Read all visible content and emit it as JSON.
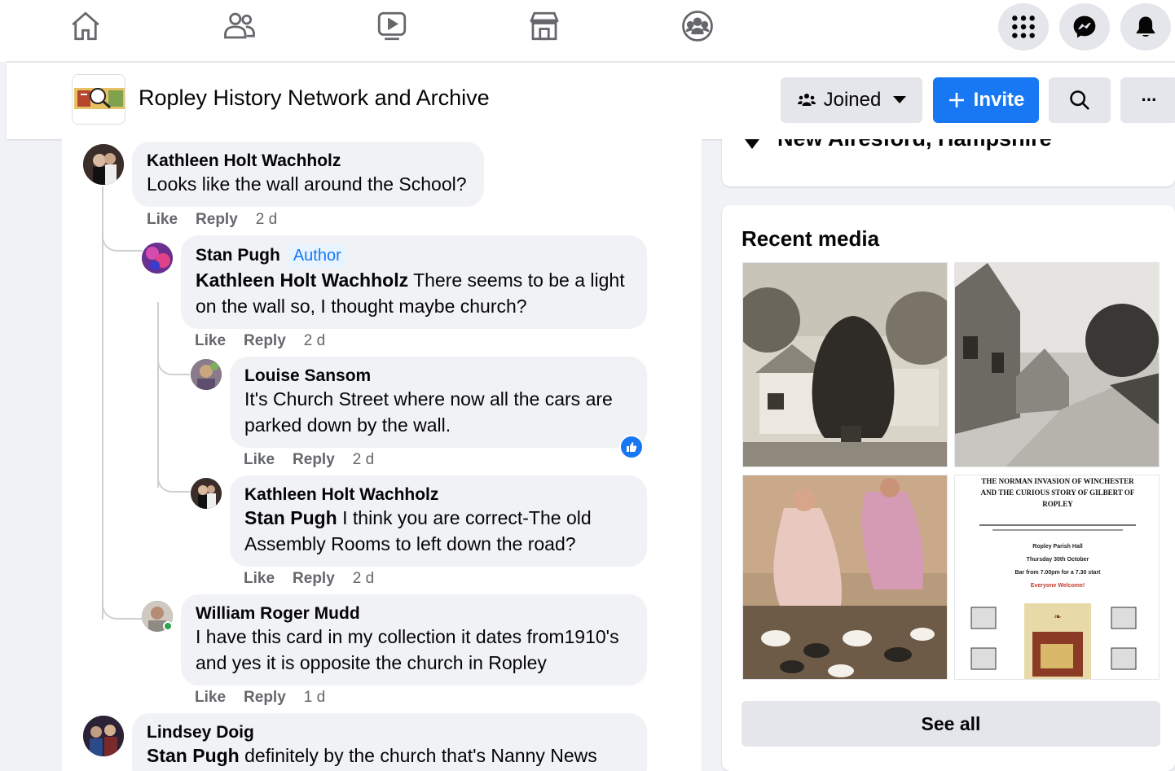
{
  "nav": {
    "icons": [
      "home-icon",
      "friends-icon",
      "watch-icon",
      "marketplace-icon",
      "groups-icon"
    ],
    "right_icons": [
      "menu-grid-icon",
      "messenger-icon",
      "notifications-icon"
    ]
  },
  "group": {
    "title": "Ropley History Network and Archive",
    "joined_label": "Joined",
    "invite_label": "Invite",
    "more_label": "···"
  },
  "comments": [
    {
      "name": "Kathleen Holt Wachholz",
      "text": "Looks like the wall around the School?",
      "like": "Like",
      "reply": "Reply",
      "time": "2 d"
    },
    {
      "name": "Stan Pugh",
      "badge": "Author",
      "mention": "Kathleen Holt Wachholz",
      "text": " There seems to be a light on the wall so, I thought maybe church?",
      "like": "Like",
      "reply": "Reply",
      "time": "2 d"
    },
    {
      "name": "Louise Sansom",
      "text": "It's Church Street where now all the cars are parked down by the wall.",
      "like": "Like",
      "reply": "Reply",
      "time": "2 d"
    },
    {
      "name": "Kathleen Holt Wachholz",
      "mention": "Stan Pugh",
      "text": " I think you are correct-The old Assembly Rooms to left down the road?",
      "like": "Like",
      "reply": "Reply",
      "time": "2 d"
    },
    {
      "name": "William Roger Mudd",
      "text": "I have this card in my collection it dates from1910's and yes it is opposite the church in Ropley",
      "like": "Like",
      "reply": "Reply",
      "time": "1 d"
    },
    {
      "name": "Lindsey Doig",
      "mention": "Stan Pugh",
      "text": " definitely by the church that's Nanny News"
    }
  ],
  "sidebar": {
    "location": "New Alresford, Hampshire",
    "recent_media_title": "Recent media",
    "see_all_label": "See all",
    "poster": {
      "line1": "THE NORMAN INVASION OF WINCHESTER",
      "line2": "AND THE CURIOUS STORY OF GILBERT OF",
      "line3": "ROPLEY",
      "venue": "Ropley Parish Hall",
      "date": "Thursday 30th October",
      "time": "Bar from 7.00pm for a 7.30 start",
      "welcome": "Everyone Welcome!"
    }
  },
  "colors": {
    "accent": "#1877f2",
    "bubble": "#f0f2f5",
    "secondary_text": "#65676b"
  }
}
